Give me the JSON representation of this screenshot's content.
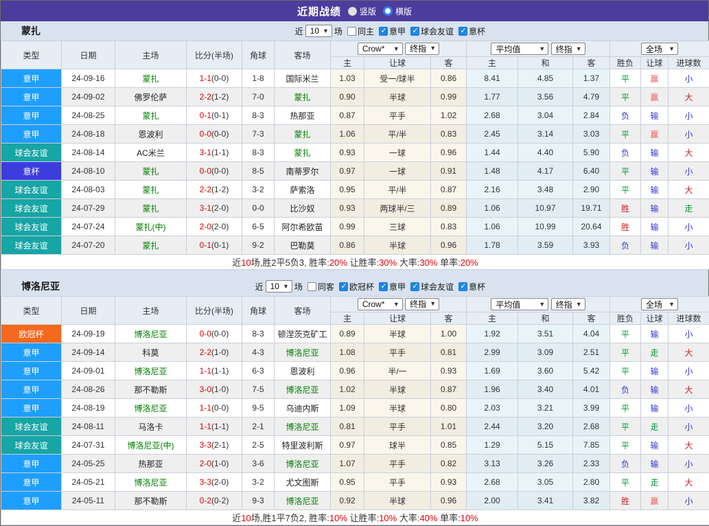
{
  "titlebar": {
    "title": "近期战绩",
    "radios": [
      {
        "label": "竖版",
        "selected": false
      },
      {
        "label": "横版",
        "selected": true
      }
    ]
  },
  "table_header": {
    "cols": [
      "类型",
      "日期",
      "主场",
      "比分(半场)",
      "角球",
      "客场"
    ],
    "odds_selects": [
      "Crow*",
      "终指"
    ],
    "odds_cols": [
      "主",
      "让球",
      "客"
    ],
    "avg_selects": [
      "平均值",
      "终指"
    ],
    "avg_cols": [
      "主",
      "和",
      "客"
    ],
    "result_select": "全场",
    "result_cols": [
      "胜负",
      "让球",
      "进球数"
    ]
  },
  "colors": {
    "header_bg": "#4b3c9e",
    "league": {
      "意甲": "#1e9fff",
      "球会友谊": "#17a5a5",
      "意杯": "#3d3ddf",
      "欧冠杯": "#f4691d"
    },
    "result": {
      "g": "#009933",
      "b": "#3338cc",
      "r": "#cc2222",
      "p": "#f05a5a"
    },
    "result_map": {
      "平": "g",
      "负": "b",
      "胜": "r",
      "赢": "p",
      "输": "b",
      "走": "g",
      "小": "b",
      "大": "r"
    }
  },
  "sections": [
    {
      "team": "蒙扎",
      "filter": {
        "prefix": "近",
        "select_value": "10",
        "suffix": "场",
        "checkboxes": [
          {
            "label": "同主",
            "checked": false
          },
          {
            "label": "意甲",
            "checked": true
          },
          {
            "label": "球会友谊",
            "checked": true
          },
          {
            "label": "意杯",
            "checked": true
          }
        ]
      },
      "rows": [
        {
          "type": "意甲",
          "date": "24-09-16",
          "home": "蒙扎",
          "home_self": true,
          "score": "1-1",
          "half": "(0-0)",
          "corner": "1-8",
          "away": "国际米兰",
          "away_self": false,
          "odds": [
            "1.03",
            "受一/球半",
            "0.86"
          ],
          "avg": [
            "8.41",
            "4.85",
            "1.37"
          ],
          "res": [
            "平",
            "赢",
            "小"
          ]
        },
        {
          "type": "意甲",
          "date": "24-09-02",
          "home": "佛罗伦萨",
          "home_self": false,
          "score": "2-2",
          "half": "(1-2)",
          "corner": "7-0",
          "away": "蒙扎",
          "away_self": true,
          "odds": [
            "0.90",
            "半球",
            "0.99"
          ],
          "avg": [
            "1.77",
            "3.56",
            "4.79"
          ],
          "res": [
            "平",
            "赢",
            "大"
          ]
        },
        {
          "type": "意甲",
          "date": "24-08-25",
          "home": "蒙扎",
          "home_self": true,
          "score": "0-1",
          "half": "(0-1)",
          "corner": "8-3",
          "away": "热那亚",
          "away_self": false,
          "odds": [
            "0.87",
            "平手",
            "1.02"
          ],
          "avg": [
            "2.68",
            "3.04",
            "2.84"
          ],
          "res": [
            "负",
            "输",
            "小"
          ]
        },
        {
          "type": "意甲",
          "date": "24-08-18",
          "home": "恩波利",
          "home_self": false,
          "score": "0-0",
          "half": "(0-0)",
          "corner": "7-3",
          "away": "蒙扎",
          "away_self": true,
          "odds": [
            "1.06",
            "平/半",
            "0.83"
          ],
          "avg": [
            "2.45",
            "3.14",
            "3.03"
          ],
          "res": [
            "平",
            "赢",
            "小"
          ]
        },
        {
          "type": "球会友谊",
          "date": "24-08-14",
          "home": "AC米兰",
          "home_self": false,
          "score": "3-1",
          "half": "(1-1)",
          "corner": "8-3",
          "away": "蒙扎",
          "away_self": true,
          "odds": [
            "0.93",
            "一球",
            "0.96"
          ],
          "avg": [
            "1.44",
            "4.40",
            "5.90"
          ],
          "res": [
            "负",
            "输",
            "大"
          ]
        },
        {
          "type": "意杯",
          "date": "24-08-10",
          "home": "蒙扎",
          "home_self": true,
          "score": "0-0",
          "half": "(0-0)",
          "corner": "8-5",
          "away": "南蒂罗尔",
          "away_self": false,
          "odds": [
            "0.97",
            "一球",
            "0.91"
          ],
          "avg": [
            "1.48",
            "4.17",
            "6.40"
          ],
          "res": [
            "平",
            "输",
            "小"
          ]
        },
        {
          "type": "球会友谊",
          "date": "24-08-03",
          "home": "蒙扎",
          "home_self": true,
          "score": "2-2",
          "half": "(1-2)",
          "corner": "3-2",
          "away": "萨索洛",
          "away_self": false,
          "odds": [
            "0.95",
            "平/半",
            "0.87"
          ],
          "avg": [
            "2.16",
            "3.48",
            "2.90"
          ],
          "res": [
            "平",
            "输",
            "大"
          ]
        },
        {
          "type": "球会友谊",
          "date": "24-07-29",
          "home": "蒙扎",
          "home_self": true,
          "score": "3-1",
          "half": "(2-0)",
          "corner": "0-0",
          "away": "比沙奴",
          "away_self": false,
          "odds": [
            "0.93",
            "两球半/三",
            "0.89"
          ],
          "avg": [
            "1.06",
            "10.97",
            "19.71"
          ],
          "res": [
            "胜",
            "输",
            "走"
          ]
        },
        {
          "type": "球会友谊",
          "date": "24-07-24",
          "home": "蒙扎(中)",
          "home_self": true,
          "score": "2-0",
          "half": "(2-0)",
          "corner": "6-5",
          "away": "阿尔希欧苗",
          "away_self": false,
          "odds": [
            "0.99",
            "三球",
            "0.83"
          ],
          "avg": [
            "1.06",
            "10.99",
            "20.64"
          ],
          "res": [
            "胜",
            "输",
            "小"
          ]
        },
        {
          "type": "球会友谊",
          "date": "24-07-20",
          "home": "蒙扎",
          "home_self": true,
          "score": "0-1",
          "half": "(0-1)",
          "corner": "9-2",
          "away": "巴勒莫",
          "away_self": false,
          "odds": [
            "0.86",
            "半球",
            "0.96"
          ],
          "avg": [
            "1.78",
            "3.59",
            "3.93"
          ],
          "res": [
            "负",
            "输",
            "小"
          ]
        }
      ],
      "summary": [
        {
          "text": "近",
          "red": false
        },
        {
          "text": "10",
          "red": true
        },
        {
          "text": "场,胜2平5负3, 胜率:",
          "red": false
        },
        {
          "text": "20%",
          "red": true
        },
        {
          "text": " 让胜率:",
          "red": false
        },
        {
          "text": "30%",
          "red": true
        },
        {
          "text": " 大率:",
          "red": false
        },
        {
          "text": "30%",
          "red": true
        },
        {
          "text": " 单率:",
          "red": false
        },
        {
          "text": "20%",
          "red": true
        }
      ]
    },
    {
      "team": "博洛尼亚",
      "filter": {
        "prefix": "近",
        "select_value": "10",
        "suffix": "场",
        "checkboxes": [
          {
            "label": "同客",
            "checked": false
          },
          {
            "label": "欧冠杯",
            "checked": true
          },
          {
            "label": "意甲",
            "checked": true
          },
          {
            "label": "球会友谊",
            "checked": true
          },
          {
            "label": "意杯",
            "checked": true
          }
        ]
      },
      "rows": [
        {
          "type": "欧冠杯",
          "date": "24-09-19",
          "home": "博洛尼亚",
          "home_self": true,
          "score": "0-0",
          "half": "(0-0)",
          "corner": "8-3",
          "away": "顿涅茨克矿工",
          "away_self": false,
          "odds": [
            "0.89",
            "半球",
            "1.00"
          ],
          "avg": [
            "1.92",
            "3.51",
            "4.04"
          ],
          "res": [
            "平",
            "输",
            "小"
          ]
        },
        {
          "type": "意甲",
          "date": "24-09-14",
          "home": "科莫",
          "home_self": false,
          "score": "2-2",
          "half": "(1-0)",
          "corner": "4-3",
          "away": "博洛尼亚",
          "away_self": true,
          "odds": [
            "1.08",
            "平手",
            "0.81"
          ],
          "avg": [
            "2.99",
            "3.09",
            "2.51"
          ],
          "res": [
            "平",
            "走",
            "大"
          ]
        },
        {
          "type": "意甲",
          "date": "24-09-01",
          "home": "博洛尼亚",
          "home_self": true,
          "score": "1-1",
          "half": "(1-1)",
          "corner": "6-3",
          "away": "恩波利",
          "away_self": false,
          "odds": [
            "0.96",
            "半/一",
            "0.93"
          ],
          "avg": [
            "1.69",
            "3.60",
            "5.42"
          ],
          "res": [
            "平",
            "输",
            "小"
          ]
        },
        {
          "type": "意甲",
          "date": "24-08-26",
          "home": "那不勒斯",
          "home_self": false,
          "score": "3-0",
          "half": "(1-0)",
          "corner": "7-5",
          "away": "博洛尼亚",
          "away_self": true,
          "odds": [
            "1.02",
            "半球",
            "0.87"
          ],
          "avg": [
            "1.96",
            "3.40",
            "4.01"
          ],
          "res": [
            "负",
            "输",
            "大"
          ]
        },
        {
          "type": "意甲",
          "date": "24-08-19",
          "home": "博洛尼亚",
          "home_self": true,
          "score": "1-1",
          "half": "(0-0)",
          "corner": "9-5",
          "away": "乌迪内斯",
          "away_self": false,
          "odds": [
            "1.09",
            "半球",
            "0.80"
          ],
          "avg": [
            "2.03",
            "3.21",
            "3.99"
          ],
          "res": [
            "平",
            "输",
            "小"
          ]
        },
        {
          "type": "球会友谊",
          "date": "24-08-11",
          "home": "马洛卡",
          "home_self": false,
          "score": "1-1",
          "half": "(1-1)",
          "corner": "2-1",
          "away": "博洛尼亚",
          "away_self": true,
          "odds": [
            "0.81",
            "平手",
            "1.01"
          ],
          "avg": [
            "2.44",
            "3.20",
            "2.68"
          ],
          "res": [
            "平",
            "走",
            "小"
          ]
        },
        {
          "type": "球会友谊",
          "date": "24-07-31",
          "home": "博洛尼亚(中)",
          "home_self": true,
          "score": "3-3",
          "half": "(2-1)",
          "corner": "2-5",
          "away": "特里波利斯",
          "away_self": false,
          "odds": [
            "0.97",
            "球半",
            "0.85"
          ],
          "avg": [
            "1.29",
            "5.15",
            "7.85"
          ],
          "res": [
            "平",
            "输",
            "大"
          ]
        },
        {
          "type": "意甲",
          "date": "24-05-25",
          "home": "热那亚",
          "home_self": false,
          "score": "2-0",
          "half": "(1-0)",
          "corner": "3-6",
          "away": "博洛尼亚",
          "away_self": true,
          "odds": [
            "1.07",
            "平手",
            "0.82"
          ],
          "avg": [
            "3.13",
            "3.26",
            "2.33"
          ],
          "res": [
            "负",
            "输",
            "小"
          ]
        },
        {
          "type": "意甲",
          "date": "24-05-21",
          "home": "博洛尼亚",
          "home_self": true,
          "score": "3-3",
          "half": "(2-0)",
          "corner": "3-2",
          "away": "尤文图斯",
          "away_self": false,
          "odds": [
            "0.95",
            "平手",
            "0.93"
          ],
          "avg": [
            "2.68",
            "3.05",
            "2.80"
          ],
          "res": [
            "平",
            "走",
            "大"
          ]
        },
        {
          "type": "意甲",
          "date": "24-05-11",
          "home": "那不勒斯",
          "home_self": false,
          "score": "0-2",
          "half": "(0-2)",
          "corner": "9-3",
          "away": "博洛尼亚",
          "away_self": true,
          "odds": [
            "0.92",
            "半球",
            "0.96"
          ],
          "avg": [
            "2.00",
            "3.41",
            "3.82"
          ],
          "res": [
            "胜",
            "赢",
            "小"
          ]
        }
      ],
      "summary": [
        {
          "text": "近",
          "red": false
        },
        {
          "text": "10",
          "red": true
        },
        {
          "text": "场,胜1平7负2, 胜率:",
          "red": false
        },
        {
          "text": "10%",
          "red": true
        },
        {
          "text": " 让胜率:",
          "red": false
        },
        {
          "text": "10%",
          "red": true
        },
        {
          "text": " 大率:",
          "red": false
        },
        {
          "text": "40%",
          "red": true
        },
        {
          "text": " 单率:",
          "red": false
        },
        {
          "text": "10%",
          "red": true
        }
      ]
    }
  ]
}
